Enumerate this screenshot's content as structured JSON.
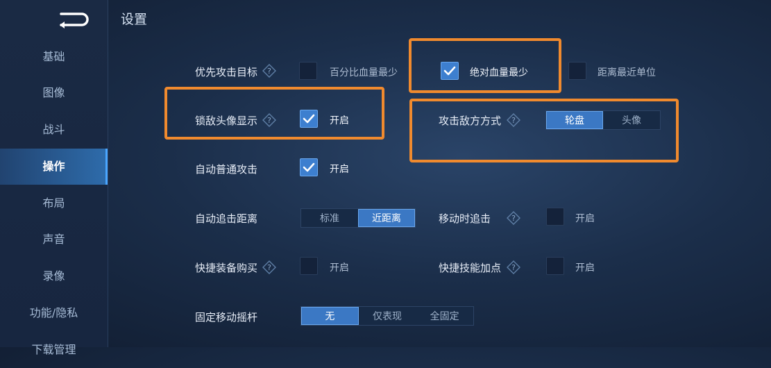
{
  "sidebar": {
    "items": [
      {
        "label": "基础"
      },
      {
        "label": "图像"
      },
      {
        "label": "战斗"
      },
      {
        "label": "操作"
      },
      {
        "label": "布局"
      },
      {
        "label": "声音"
      },
      {
        "label": "录像"
      },
      {
        "label": "功能/隐私"
      },
      {
        "label": "下载管理"
      }
    ],
    "active": "操作"
  },
  "header": {
    "title": "设置"
  },
  "settings": {
    "priority_target": {
      "label": "优先攻击目标",
      "options": [
        {
          "label": "百分比血量最少",
          "checked": false
        },
        {
          "label": "绝对血量最少",
          "checked": true
        },
        {
          "label": "距离最近单位",
          "checked": false
        }
      ]
    },
    "lock_avatar": {
      "label": "锁敌头像显示",
      "option": "开启",
      "checked": true
    },
    "attack_mode": {
      "label": "攻击敌方方式",
      "segments": [
        "轮盘",
        "头像"
      ],
      "selected": "轮盘"
    },
    "auto_attack": {
      "label": "自动普通攻击",
      "option": "开启",
      "checked": true
    },
    "chase_distance": {
      "label": "自动追击距离",
      "segments": [
        "标准",
        "近距离"
      ],
      "selected": "近距离"
    },
    "move_chase": {
      "label": "移动时追击",
      "option": "开启",
      "checked": false
    },
    "quick_buy": {
      "label": "快捷装备购买",
      "option": "开启",
      "checked": false
    },
    "quick_skill": {
      "label": "快捷技能加点",
      "option": "开启",
      "checked": false
    },
    "joystick": {
      "label": "固定移动摇杆",
      "segments": [
        "无",
        "仅表现",
        "全固定"
      ],
      "selected": "无"
    }
  },
  "colors": {
    "highlight": "#f08a2e",
    "accent": "#3b78c4"
  }
}
